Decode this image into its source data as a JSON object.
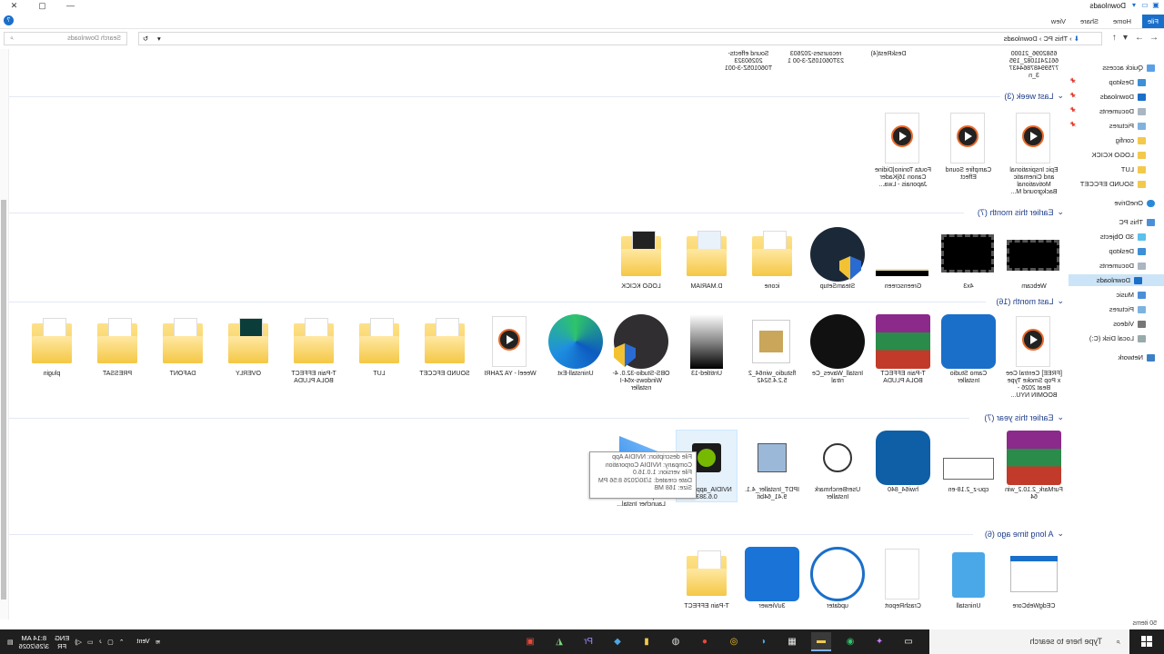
{
  "window": {
    "title": "Downloads",
    "controls": [
      "—",
      "▢",
      "✕"
    ]
  },
  "ribbon": {
    "tabs": [
      "File",
      "Home",
      "Share",
      "View"
    ]
  },
  "address": {
    "crumbs": [
      "This PC",
      "Downloads"
    ],
    "search_placeholder": "Search Downloads"
  },
  "nav": {
    "quick_access": "Quick access",
    "items": [
      {
        "label": "Desktop",
        "pinned": true
      },
      {
        "label": "Downloads",
        "pinned": true
      },
      {
        "label": "Documents",
        "pinned": true
      },
      {
        "label": "Pictures",
        "pinned": true
      },
      {
        "label": "config"
      },
      {
        "label": "LOGO KCICK"
      },
      {
        "label": "LUT"
      },
      {
        "label": "SOUND EFCCET"
      }
    ],
    "onedrive": "OneDrive",
    "this_pc": "This PC",
    "pc_items": [
      "3D Objects",
      "Desktop",
      "Documents",
      "Downloads",
      "Music",
      "Pictures",
      "Videos",
      "Local Disk (C:)"
    ],
    "network": "Network"
  },
  "top_row": [
    {
      "label": "DeskRest(4)"
    },
    {
      "label": "recourses-202603 23T060105Z-3-00 1"
    },
    {
      "label": "Sound effects-20260323 T060105Z-3-001"
    },
    {
      "label": "6582096_21000 6612411082_195 77599487864437 3_n"
    }
  ],
  "groups": {
    "last_week": "Last week (3)",
    "earlier_month": "Earlier this month (7)",
    "last_month": "Last month (16)",
    "earlier_year": "Earlier this year (7)",
    "long_ago": "A long time ago (6)"
  },
  "last_week_items": [
    {
      "label": "Epic Inspirational and Cinematic Motivational Background M..."
    },
    {
      "label": "Campfire Sound Effect"
    },
    {
      "label": "Fouta Tonino|Didine Canon 16|Kader Japonais - Lwa..."
    }
  ],
  "month_items": [
    {
      "label": "Webcam"
    },
    {
      "label": "4x3"
    },
    {
      "label": "Greenscreen"
    },
    {
      "label": "SteamSetup"
    },
    {
      "label": "icone"
    },
    {
      "label": "D.MARIAM"
    },
    {
      "label": "LOGO KCICK"
    }
  ],
  "last_month_items": [
    {
      "label": "[FREE] Central Cee x Pop Smoke Type Beat 2026 - BOOMIN NYU..."
    },
    {
      "label": "Camo Studio Installer"
    },
    {
      "label": "T-Pain EFFECT BOLA PLUDA"
    },
    {
      "label": "Install_Waves_Ce ntral"
    },
    {
      "label": "flstudio_win64_2 5.2.4.5242"
    },
    {
      "label": "Untitled-13"
    },
    {
      "label": "OBS-Studio-32.0. 4-Windows-x64-I nstaller"
    },
    {
      "label": "Uninstall-Ext"
    },
    {
      "label": "Weeel - YA ZAHRI"
    },
    {
      "label": "SOUND EFCCET"
    },
    {
      "label": "LUT"
    },
    {
      "label": "T-Pain EFFECT BOLA PLUDA"
    },
    {
      "label": "OVERLY"
    },
    {
      "label": "DAFONT"
    },
    {
      "label": "PRESSAT"
    },
    {
      "label": "plugin"
    }
  ],
  "year_items": [
    {
      "label": "FurMark_2.10.2_win64"
    },
    {
      "label": "cpu-z_2.18-en"
    },
    {
      "label": "hwi64_840"
    },
    {
      "label": "UserBenchmark Installer"
    },
    {
      "label": "IPDT_Installer_4.1. 9.41_64bit"
    },
    {
      "label": "NVIDIA_app_v11. 0.6.383"
    },
    {
      "label": "Chrome Discord Epic Games Launcher Instal..."
    }
  ],
  "old_items": [
    {
      "label": "CEdgWebCore"
    },
    {
      "label": "Uninstall"
    },
    {
      "label": "CrashReport"
    },
    {
      "label": "updater"
    },
    {
      "label": "3uViewer"
    },
    {
      "label": "T-Pain EFFECT"
    }
  ],
  "tooltip": {
    "lines": [
      "File description: NVIDIA App",
      "Company: NVIDIA Corporation",
      "File version: 1.0.16.0",
      "Date created: 1/30/2026 8:56 PM",
      "Size: 168 MB"
    ]
  },
  "status": {
    "count": "50 items"
  },
  "taskbar": {
    "search_placeholder": "Type here to search",
    "weather": "Vent",
    "lang_top": "ENG",
    "lang_bottom": "FR",
    "time": "8:14 AM",
    "date": "3/26/2026"
  },
  "colors": {
    "accent": "#1a6fc9",
    "selection": "#cce4f7",
    "group_header": "#1e3d8a",
    "taskbar": "#1f1f1f"
  }
}
